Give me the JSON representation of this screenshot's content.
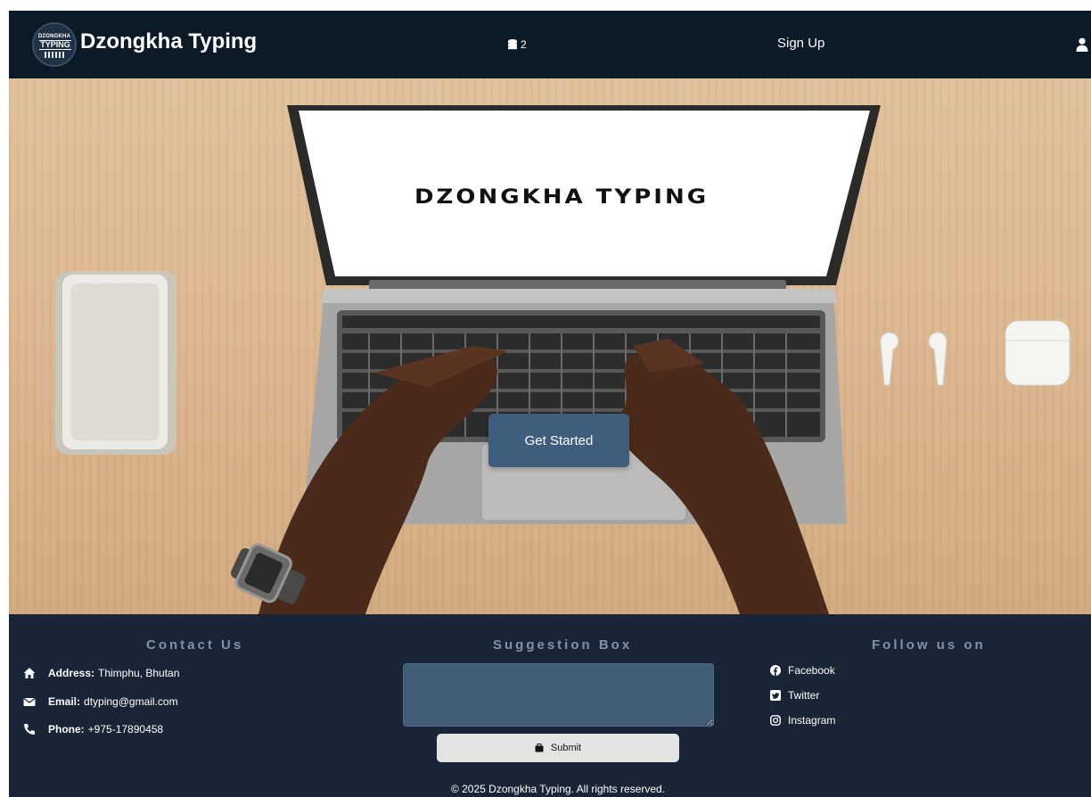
{
  "header": {
    "logo": {
      "line1": "DZONGKHA",
      "line2": "TYPING"
    },
    "title": "Dzongkha Typing",
    "coins": {
      "icon": "coins-icon",
      "count": "2"
    },
    "signup_label": "Sign Up",
    "user_icon": "user-icon"
  },
  "hero": {
    "screen_text": "DZONGKHA TYPING",
    "cta_label": "Get Started"
  },
  "footer": {
    "contact": {
      "heading": "Contact Us",
      "address_label": "Address:",
      "address": "Thimphu, Bhutan",
      "email_label": "Email:",
      "email": "dtyping@gmail.com",
      "phone_label": "Phone:",
      "phone": "+975-17890458"
    },
    "suggestion": {
      "heading": "Suggestion Box",
      "placeholder": "",
      "submit_label": "Submit"
    },
    "follow": {
      "heading": "Follow us on",
      "links": [
        {
          "label": "Facebook",
          "icon": "facebook-icon"
        },
        {
          "label": "Twitter",
          "icon": "twitter-icon"
        },
        {
          "label": "Instagram",
          "icon": "instagram-icon"
        }
      ]
    },
    "copyright": "© 2025 Dzongkha Typing. All rights reserved."
  },
  "colors": {
    "header_bg": "#0c1a28",
    "footer_bg": "#192436",
    "heading_accent": "#7f93ad",
    "button_primary": "#3f5e7d",
    "textarea_bg": "#425b77"
  }
}
